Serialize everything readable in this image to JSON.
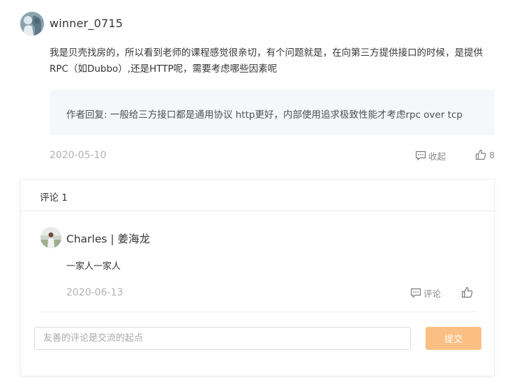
{
  "main_comment": {
    "username": "winner_0715",
    "text": "我是贝壳找房的，所以看到老师的课程感觉很亲切，有个问题就是，在向第三方提供接口的时候，是提供RPC（如Dubbo）,还是HTTP呢，需要考虑哪些因素呢",
    "author_reply": "作者回复: 一般给三方接口都是通用协议 http更好，内部使用追求极致性能才考虑rpc over tcp",
    "date": "2020-05-10",
    "collapse_label": "收起",
    "like_count": "8",
    "icons": {
      "avatar": "avatar-image",
      "collapse": "comment-bubble-icon",
      "like": "thumbs-up-icon"
    }
  },
  "comments_panel": {
    "title": "评论 1",
    "items": [
      {
        "username": "Charles | 姜海龙",
        "text": "一家人一家人",
        "date": "2020-06-13",
        "reply_label": "评论"
      }
    ],
    "input": {
      "value": "",
      "placeholder": "友善的评论是交流的起点"
    },
    "submit_label": "提交"
  },
  "colors": {
    "submit_button": "#fbbf83",
    "date_text": "#b2b2b2",
    "reply_background": "#f6f7fb"
  }
}
